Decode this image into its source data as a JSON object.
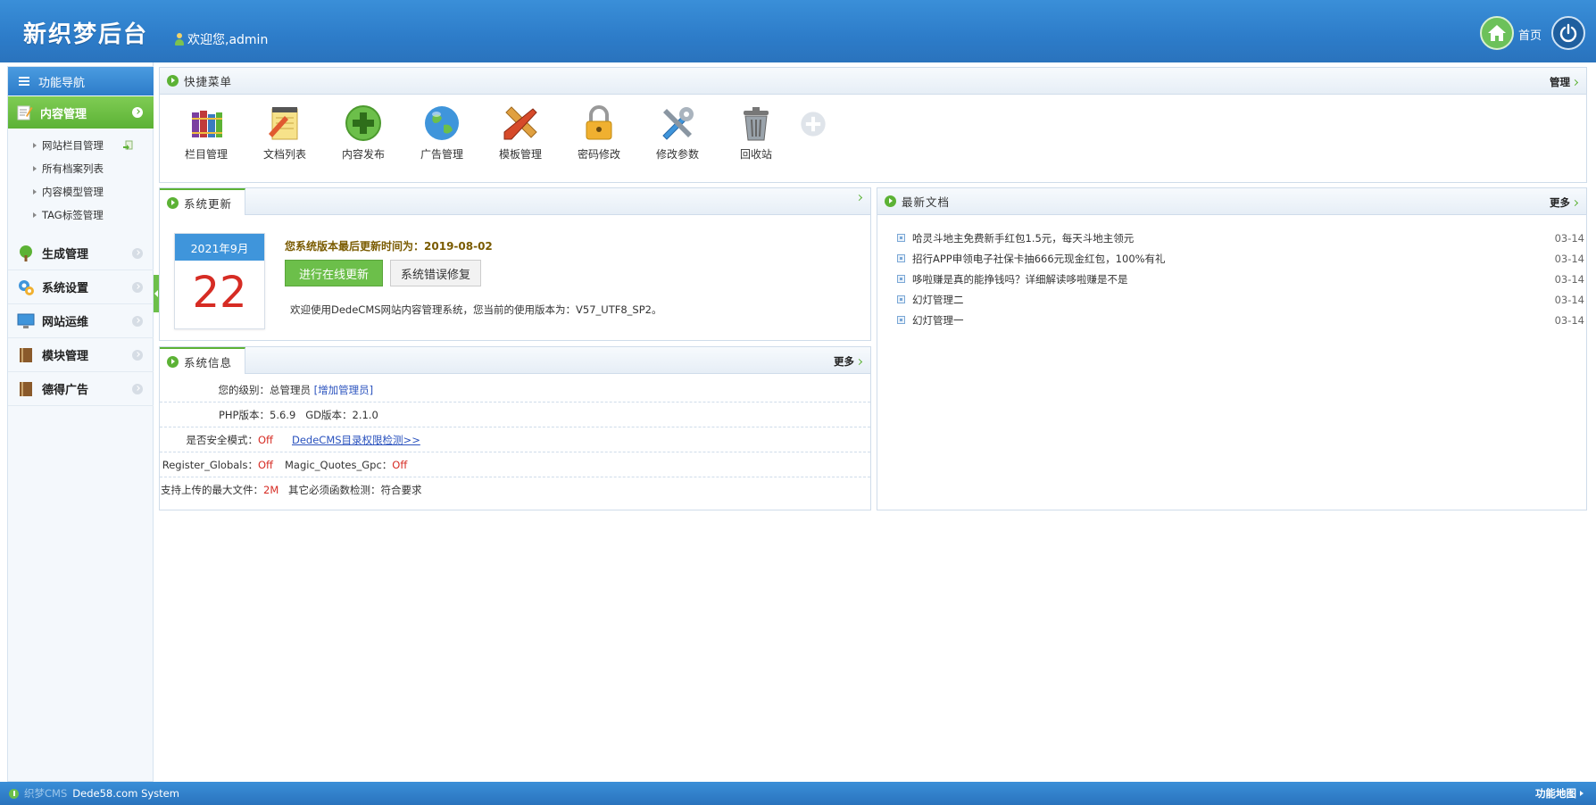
{
  "header": {
    "logo": "新织梦后台",
    "welcome": "欢迎您,admin",
    "home_label": "首页"
  },
  "sidebar": {
    "nav_title": "功能导航",
    "active_menu": "内容管理",
    "sub_items": [
      {
        "label": "网站栏目管理"
      },
      {
        "label": "所有档案列表"
      },
      {
        "label": "内容模型管理"
      },
      {
        "label": "TAG标签管理"
      }
    ],
    "menus": [
      {
        "label": "生成管理",
        "icon": "tree-icon"
      },
      {
        "label": "系统设置",
        "icon": "settings-icon"
      },
      {
        "label": "网站运维",
        "icon": "monitor-icon"
      },
      {
        "label": "模块管理",
        "icon": "book-icon"
      },
      {
        "label": "德得广告",
        "icon": "book-icon"
      }
    ]
  },
  "quick_menu": {
    "title": "快捷菜单",
    "manage_label": "管理",
    "items": [
      {
        "label": "栏目管理",
        "icon": "books-icon"
      },
      {
        "label": "文档列表",
        "icon": "notepad-icon"
      },
      {
        "label": "内容发布",
        "icon": "green-plus-icon"
      },
      {
        "label": "广告管理",
        "icon": "globe-icon"
      },
      {
        "label": "模板管理",
        "icon": "pencil-ruler-icon"
      },
      {
        "label": "密码修改",
        "icon": "lock-icon"
      },
      {
        "label": "修改参数",
        "icon": "tools-icon"
      },
      {
        "label": "回收站",
        "icon": "trash-icon"
      }
    ]
  },
  "system_update": {
    "title": "系统更新",
    "calendar_month": "2021年9月",
    "calendar_day": "22",
    "last_update_label": "您系统版本最后更新时间为：",
    "last_update_date": "2019-08-02",
    "online_update_button": "进行在线更新",
    "repair_button": "系统错误修复",
    "description": "欢迎使用DedeCMS网站内容管理系统，您当前的使用版本为：V57_UTF8_SP2。"
  },
  "system_info": {
    "title": "系统信息",
    "more_label": "更多",
    "level_label": "您的级别：",
    "level_value": "总管理员",
    "add_admin_link": "[增加管理员]",
    "php_label": "PHP版本：",
    "php_value": "5.6.9",
    "gd_label": "GD版本：",
    "gd_value": "2.1.0",
    "safe_mode_label": "是否安全模式：",
    "safe_mode_value": "Off",
    "perm_check_link": "DedeCMS目录权限检测>>",
    "register_globals_label": "Register_Globals：",
    "register_globals_value": "Off",
    "magic_quotes_label": "Magic_Quotes_Gpc：",
    "magic_quotes_value": "Off",
    "max_upload_label": "支持上传的最大文件：",
    "max_upload_value": "2M",
    "functions_label": "其它必须函数检测：",
    "functions_value": "符合要求"
  },
  "latest_docs": {
    "title": "最新文档",
    "more_label": "更多",
    "items": [
      {
        "title": "哈灵斗地主免费新手红包1.5元，每天斗地主领元",
        "date": "03-14"
      },
      {
        "title": "招行APP申领电子社保卡抽666元现金红包，100%有礼",
        "date": "03-14"
      },
      {
        "title": "哆啦赚是真的能挣钱吗？详细解读哆啦赚是不是",
        "date": "03-14"
      },
      {
        "title": "幻灯管理二",
        "date": "03-14"
      },
      {
        "title": "幻灯管理一",
        "date": "03-14"
      }
    ]
  },
  "footer": {
    "brand": "织梦CMS",
    "system": "Dede58.com System",
    "sitemap": "功能地图"
  },
  "colors": {
    "header_blue": "#2d7cc9",
    "accent_green": "#5cb235",
    "red_text": "#d62c24"
  }
}
